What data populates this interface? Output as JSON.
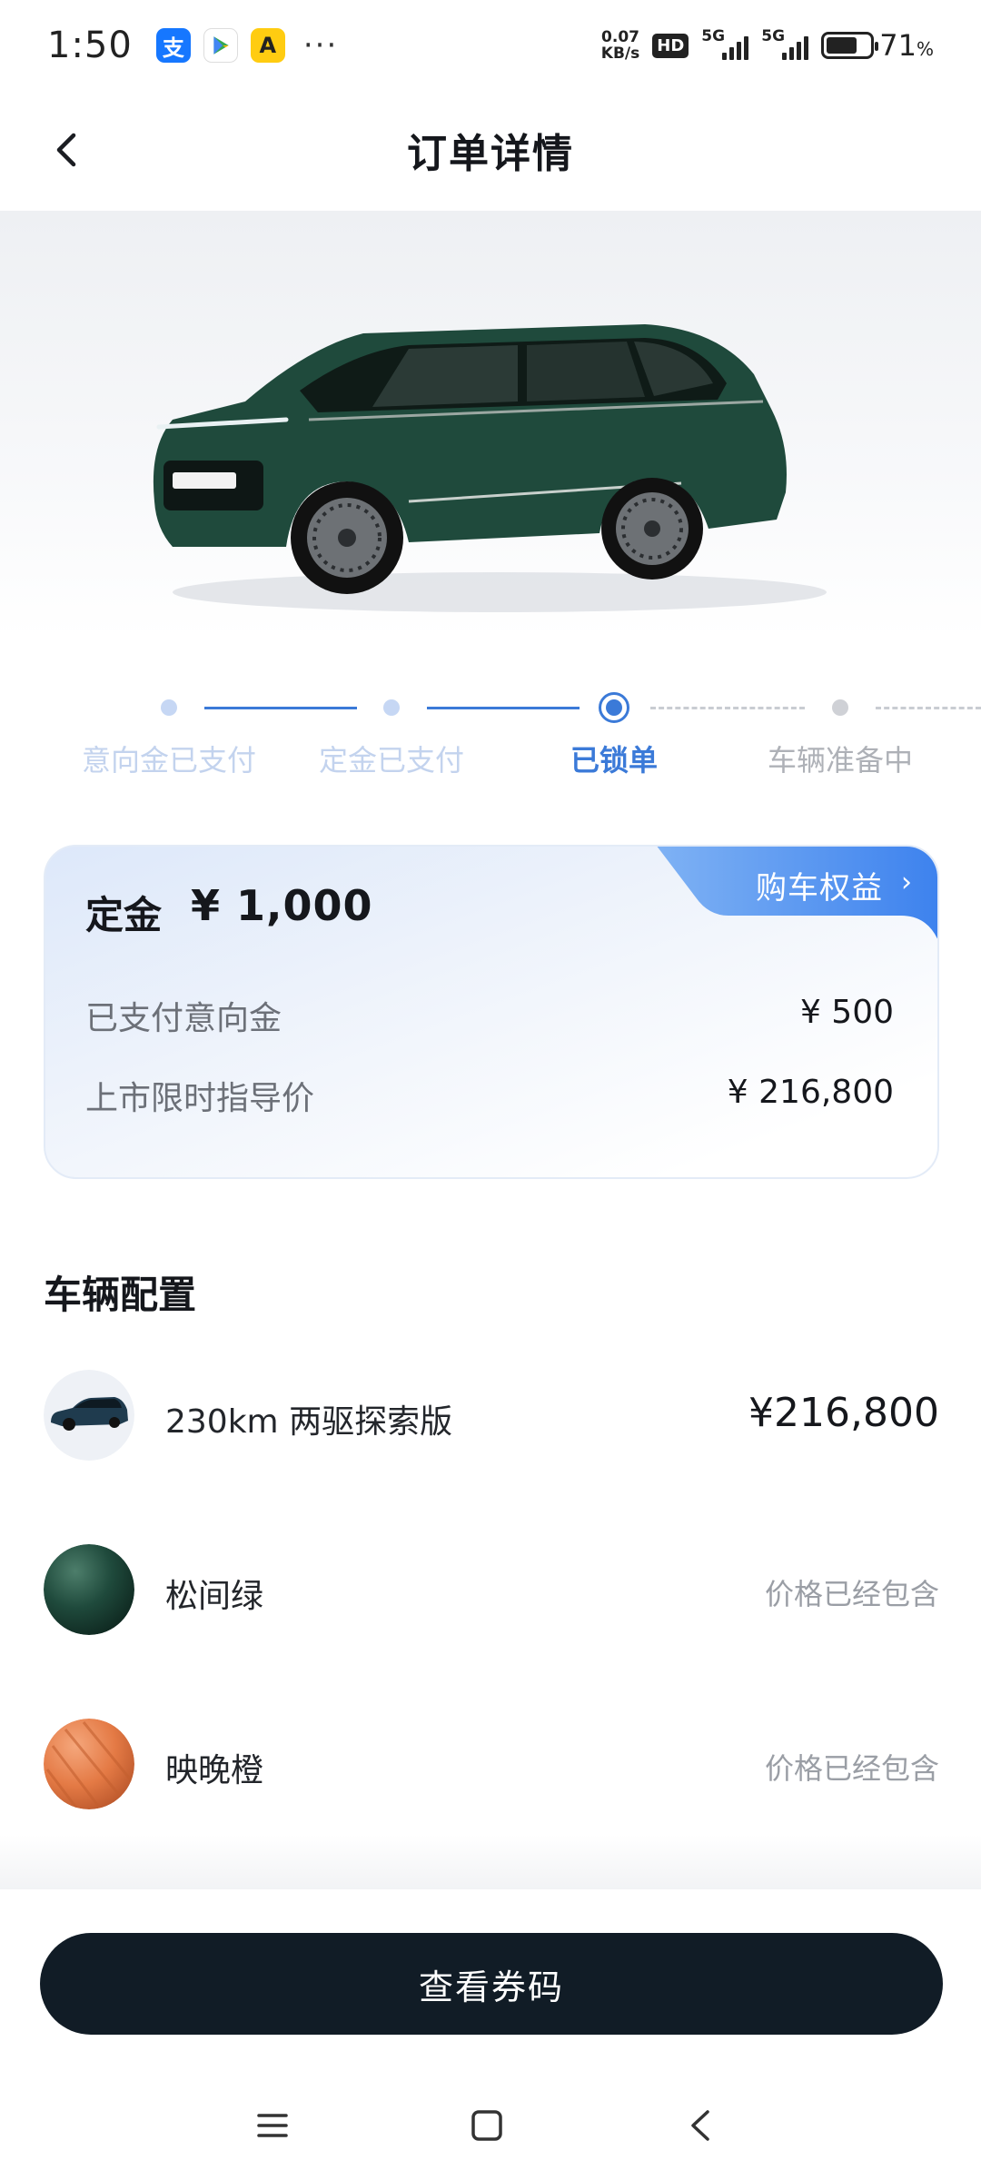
{
  "status_bar": {
    "time": "1:50",
    "apps": [
      {
        "icon": "alipay-icon",
        "glyph": "支"
      },
      {
        "icon": "play-store-icon",
        "glyph": "▶"
      },
      {
        "icon": "yellow-app-icon",
        "glyph": "A"
      }
    ],
    "more": "···",
    "net_speed_value": "0.07",
    "net_speed_unit": "KB/s",
    "hd": "HD",
    "signal1_label": "5G",
    "signal2_label": "5G",
    "battery_percent": 71,
    "battery_text": "71",
    "battery_unit": "%"
  },
  "header": {
    "title": "订单详情",
    "back_icon": "back-chevron-icon"
  },
  "progress": {
    "steps": [
      {
        "label": "意向金已支付",
        "state": "done"
      },
      {
        "label": "定金已支付",
        "state": "done"
      },
      {
        "label": "已锁单",
        "state": "current"
      },
      {
        "label": "车辆准备中",
        "state": "todo"
      }
    ]
  },
  "price_card": {
    "deposit_label": "定金",
    "deposit_amount": "¥ 1,000",
    "benefit_label": "购车权益",
    "benefit_chevron": "›",
    "rows": [
      {
        "label": "已支付意向金",
        "value": "¥ 500"
      },
      {
        "label": "上市限时指导价",
        "value": "¥ 216,800"
      }
    ]
  },
  "config": {
    "title": "车辆配置",
    "items": [
      {
        "name": "230km 两驱探索版",
        "price": "¥216,800",
        "thumb": "car-thumbnail"
      },
      {
        "name": "松间绿",
        "note": "价格已经包含",
        "thumb": "green-paint-swatch"
      },
      {
        "name": "映晚橙",
        "note": "价格已经包含",
        "thumb": "orange-interior-swatch"
      }
    ]
  },
  "bottom": {
    "button_label": "查看券码"
  },
  "colors": {
    "accent": "#3b7ad8",
    "button_bg": "#111c26",
    "car_green": "#1e4a3c",
    "interior_orange": "#e47a45"
  }
}
